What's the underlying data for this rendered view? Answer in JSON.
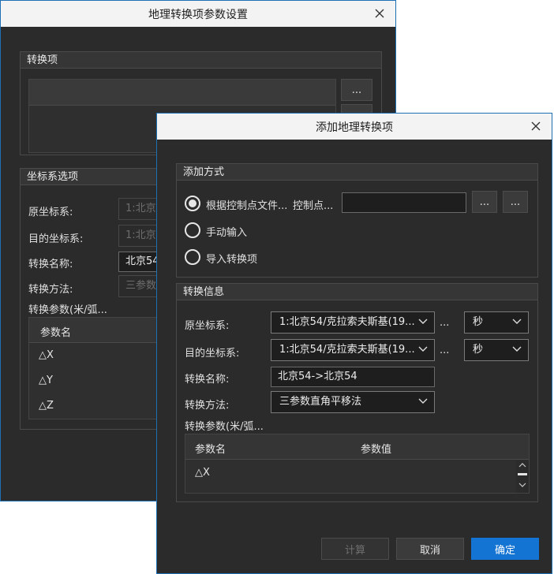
{
  "back": {
    "title": "地理转换项参数设置",
    "group_items": "转换项",
    "browse_label": "...",
    "group_coords": "坐标系选项",
    "src_label": "原坐标系:",
    "src_value": "1:北京",
    "dst_label": "目的坐标系:",
    "dst_value": "1:北京",
    "name_label": "转换名称:",
    "name_value": "北京54",
    "method_label": "转换方法:",
    "method_value": "三参数",
    "params_label": "转换参数(米/弧...",
    "param_header": "参数名",
    "rows": [
      "△X",
      "△Y",
      "△Z"
    ]
  },
  "front": {
    "title": "添加地理转换项",
    "group_method": "添加方式",
    "radio_file": "根据控制点文件...",
    "ctrl_label": "控制点...",
    "ctrl_value": "",
    "browse1": "...",
    "browse2": "...",
    "radio_manual": "手动输入",
    "radio_import": "导入转换项",
    "group_info": "转换信息",
    "src_label": "原坐标系:",
    "src_value": "1:北京54/克拉索夫斯基(19...",
    "src_more": "...",
    "src_unit": "秒",
    "dst_label": "目的坐标系:",
    "dst_value": "1:北京54/克拉索夫斯基(19...",
    "dst_more": "...",
    "dst_unit": "秒",
    "name_label": "转换名称:",
    "name_value": "北京54->北京54",
    "method_label": "转换方法:",
    "method_value": "三参数直角平移法",
    "params_label": "转换参数(米/弧...",
    "col_name": "参数名",
    "col_value": "参数值",
    "row1_name": "△X",
    "row1_value": "",
    "btn_calc": "计算",
    "btn_cancel": "取消",
    "btn_ok": "确定"
  },
  "colors": {
    "accent": "#1474d4",
    "dialog_bg": "#2b2b2b",
    "titlebar_bg": "#f3f3f3"
  }
}
